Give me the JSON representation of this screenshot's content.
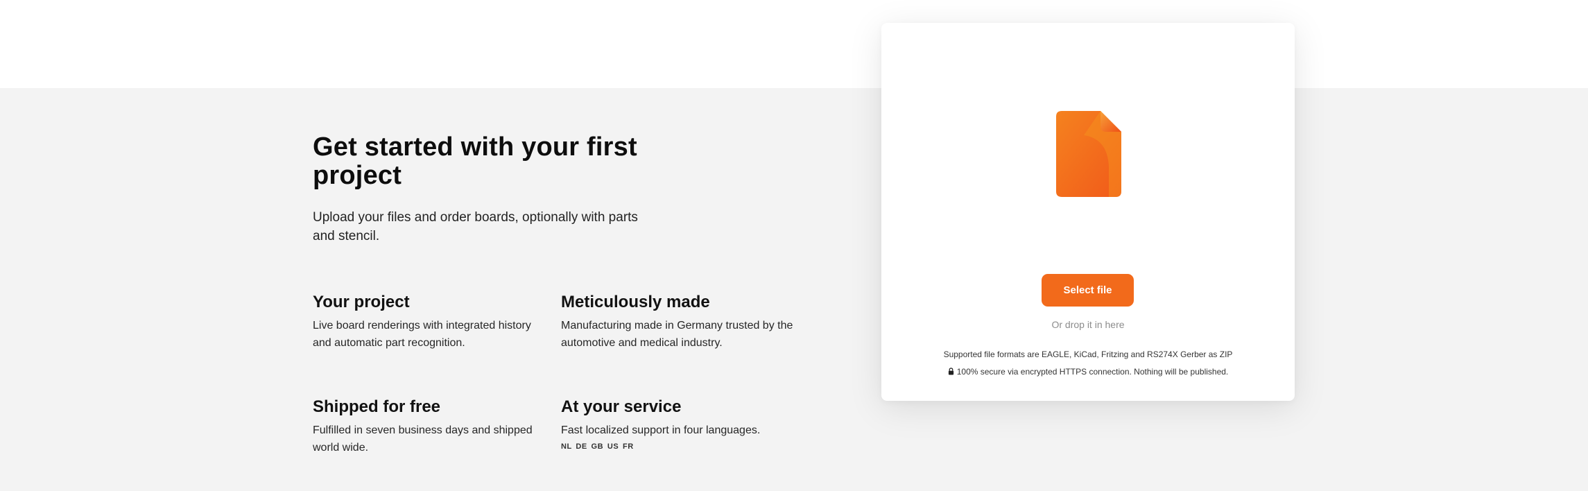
{
  "hero": {
    "title": "Get started with your first project",
    "subtitle": "Upload your files and order boards, optionally with parts and stencil."
  },
  "features": [
    {
      "title": "Your project",
      "text": "Live board renderings with integrated history and automatic part recognition."
    },
    {
      "title": "Meticulously made",
      "text": "Manufacturing made in Germany trusted by the automotive and medical industry."
    },
    {
      "title": "Shipped for free",
      "text": "Fulfilled in seven business days and shipped world wide."
    },
    {
      "title": "At your service",
      "text": "Fast localized support in four languages.",
      "languages": "NL DE GB US FR"
    }
  ],
  "upload": {
    "icon": "file-icon",
    "button_label": "Select file",
    "drop_hint": "Or drop it in here",
    "formats_text": "Supported file formats are EAGLE, KiCad, Fritzing and RS274X Gerber as ZIP",
    "secure_icon": "lock-icon",
    "secure_text": "100% secure via encrypted HTTPS connection. Nothing will be published."
  },
  "colors": {
    "accent": "#f26a1b",
    "background_band": "#f3f3f3",
    "card": "#ffffff"
  }
}
